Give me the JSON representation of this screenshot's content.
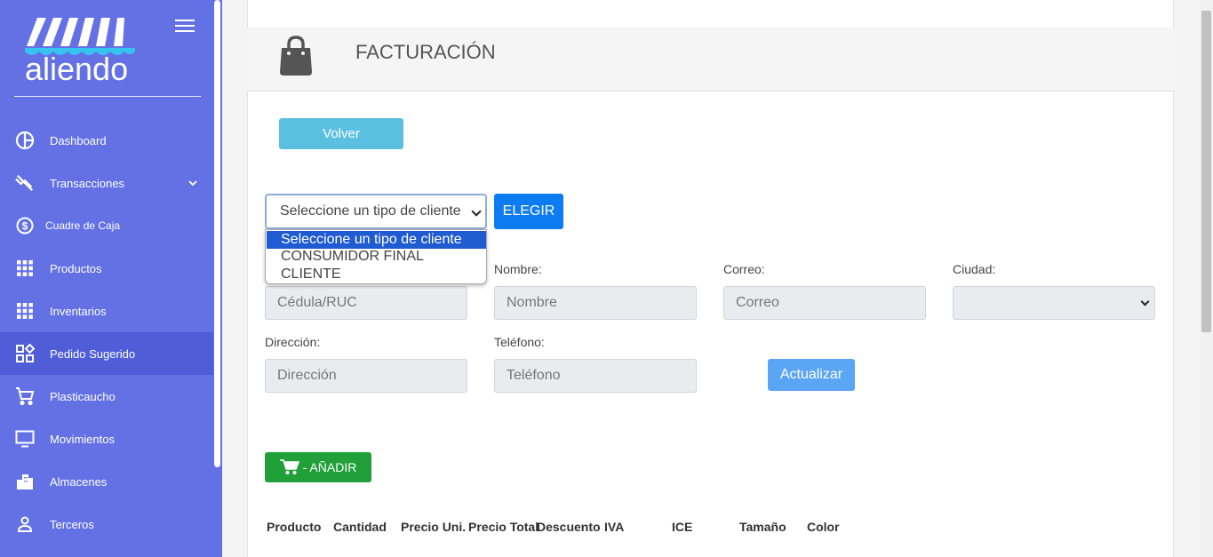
{
  "sidebar": {
    "logo_text": "aliendo",
    "items": [
      {
        "label": "Dashboard",
        "icon": "dashboard-icon"
      },
      {
        "label": "Transacciones",
        "icon": "transactions-icon"
      },
      {
        "label": "Cuadre de Caja",
        "icon": "dollar-icon"
      },
      {
        "label": "Productos",
        "icon": "grid-icon"
      },
      {
        "label": "Inventarios",
        "icon": "grid-icon"
      },
      {
        "label": "Pedido Sugerido",
        "icon": "widgets-icon",
        "active": true
      },
      {
        "label": "Plasticaucho",
        "icon": "cart-icon"
      },
      {
        "label": "Movimientos",
        "icon": "monitor-icon"
      },
      {
        "label": "Almacenes",
        "icon": "building-icon"
      },
      {
        "label": "Terceros",
        "icon": "person-icon"
      }
    ]
  },
  "header": {
    "title": "FACTURACIÓN"
  },
  "actions": {
    "volver": "Volver",
    "elegir": "ELEGIR",
    "actualizar": "Actualizar",
    "anadir": "- AÑADIR"
  },
  "client_type": {
    "selected": "Seleccione un tipo de cliente",
    "options": [
      "Seleccione un tipo de cliente",
      "CONSUMIDOR FINAL",
      "CLIENTE"
    ]
  },
  "form": {
    "nombre_label": "Nombre:",
    "correo_label": "Correo:",
    "ciudad_label": "Ciudad:",
    "direccion_label": "Dirección:",
    "telefono_label": "Teléfono:",
    "cedula_placeholder": "Cédula/RUC",
    "nombre_placeholder": "Nombre",
    "correo_placeholder": "Correo",
    "direccion_placeholder": "Dirección",
    "telefono_placeholder": "Teléfono"
  },
  "table": {
    "headers": [
      "Producto",
      "Cantidad",
      "Precio Uni.",
      "Precio Total",
      "Descuento",
      "IVA",
      "ICE",
      "Tamaño",
      "Color"
    ]
  },
  "colors": {
    "sidebar": "#6371e5",
    "sidebar_active": "#4f5ed8",
    "primary": "#0d7cf2",
    "success": "#21a03a",
    "info": "#5bc0e0"
  }
}
